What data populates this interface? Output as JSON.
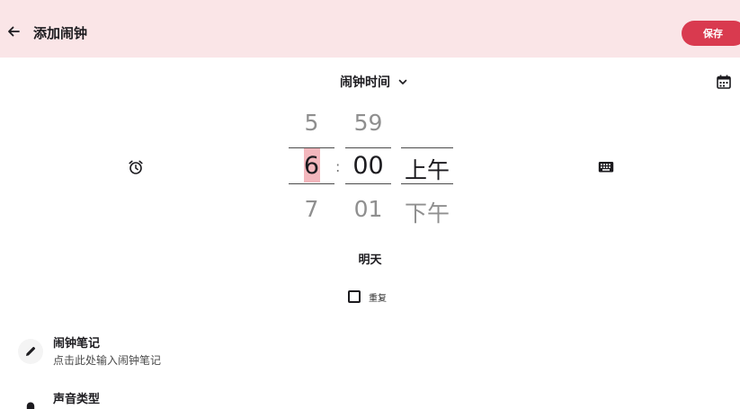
{
  "appbar": {
    "title": "添加闹钟",
    "save_label": "保存",
    "background": "#fae5e7",
    "save_color": "#d93a4f"
  },
  "time_header": {
    "label": "闹钟时间"
  },
  "picker": {
    "hour": {
      "prev": "5",
      "current": "6",
      "next": "7"
    },
    "separator": ":",
    "minute": {
      "prev": "59",
      "current": "00",
      "next": "01"
    },
    "ampm": {
      "current": "上午",
      "next": "下午"
    },
    "highlight_color": "#f3b7bd"
  },
  "day_label": "明天",
  "repeat": {
    "label": "重复",
    "checked": false
  },
  "note_row": {
    "title": "闹钟笔记",
    "subtitle": "点击此处输入闹钟笔记",
    "icon": "pencil-icon"
  },
  "sound_row": {
    "title": "声音类型",
    "icon": "bell-icon"
  },
  "icons": {
    "back": "arrow-left-icon",
    "dropdown": "chevron-down-icon",
    "calendar": "calendar-icon",
    "alarm": "alarm-clock-icon",
    "keyboard": "keyboard-icon"
  }
}
